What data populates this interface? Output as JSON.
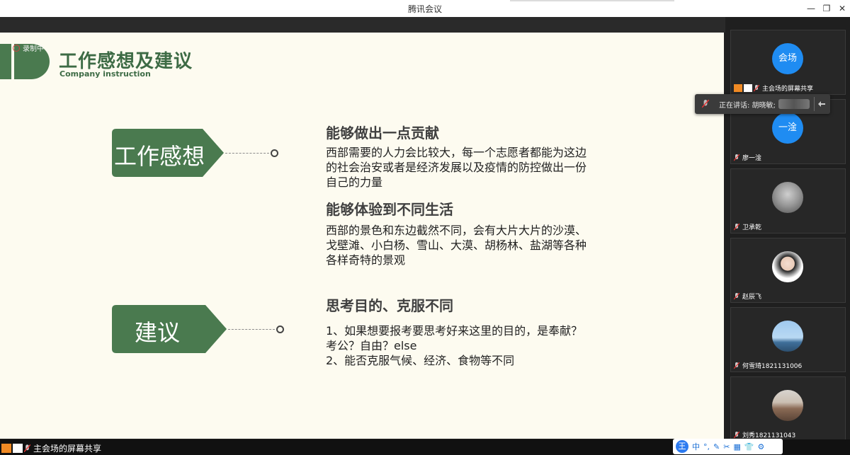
{
  "window": {
    "title": "腾讯会议"
  },
  "slide": {
    "record_label": "录制中",
    "title": "工作感想及建议",
    "subtitle": "Company instruction",
    "colors": {
      "green": "#4a7a4f",
      "title_green": "#3d6b45"
    },
    "sections": [
      {
        "tag": "工作感想",
        "items": [
          {
            "heading": "能够做出一点贡献",
            "lines": [
              "西部需要的人力会比较大，每一个志愿者都能为这边",
              "的社会治安或者是经济发展以及疫情的防控做出一份",
              "自己的力量"
            ]
          },
          {
            "heading": "能够体验到不同生活",
            "lines": [
              "西部的景色和东边截然不同，会有大片大片的沙漠、",
              "戈壁滩、小白杨、雪山、大漠、胡杨林、盐湖等各种",
              "各样奇特的景观"
            ]
          }
        ]
      },
      {
        "tag": "建议",
        "items": [
          {
            "heading": "思考目的、克服不同",
            "lines": [
              "1、如果想要报考要思考好来这里的目的，是奉献？",
              "考公？自由？else",
              "2、能否克服气候、经济、食物等不同"
            ]
          }
        ]
      }
    ]
  },
  "participants": [
    {
      "avatar_text": "会场",
      "name": "主会场的屏幕共享",
      "avatar_type": "text"
    },
    {
      "avatar_text": "一淦",
      "name": "廖一淦",
      "avatar_type": "text"
    },
    {
      "avatar_text": "",
      "name": "卫承乾",
      "avatar_type": "photo-grey"
    },
    {
      "avatar_text": "",
      "name": "赵辰飞",
      "avatar_type": "photo-person"
    },
    {
      "avatar_text": "",
      "name": "何雪琦1821131006",
      "avatar_type": "photo-sky"
    },
    {
      "avatar_text": "",
      "name": "刘秀1821131043",
      "avatar_type": "photo-city"
    }
  ],
  "speaking": {
    "label": "正在讲话: 胡晓敏;"
  },
  "bottom": {
    "share_label": "主会场的屏幕共享"
  },
  "ime": {
    "logo": "王",
    "mode": "中"
  }
}
